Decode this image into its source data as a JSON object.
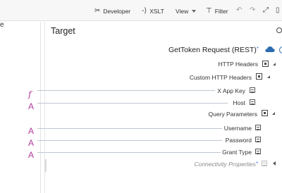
{
  "toolbar": {
    "developer_label": "Developer",
    "xslt_label": "XSLT",
    "view_label": "View",
    "filter_label": "Filter"
  },
  "left_pane": {
    "edge_glyph": "e"
  },
  "target": {
    "title": "Target",
    "root_node": "GetToken Request (REST)",
    "required_marker": "*",
    "nodes": {
      "http_headers": "HTTP Headers",
      "custom_http_headers": "Custom HTTP Headers",
      "x_app_key": "X App Key",
      "host": "Host",
      "query_parameters": "Query Parameters",
      "username": "Username",
      "password": "Password",
      "grant_type": "Grant Type",
      "connectivity_properties": "Connectivity Properties"
    }
  },
  "source_marks": {
    "x_app_key": "f",
    "host": "A",
    "username": "A",
    "password": "A",
    "grant_type": "A"
  },
  "colors": {
    "mark": "#b0389a",
    "mapping_line": "#bfc7d2",
    "accent": "#3d7fd6"
  }
}
